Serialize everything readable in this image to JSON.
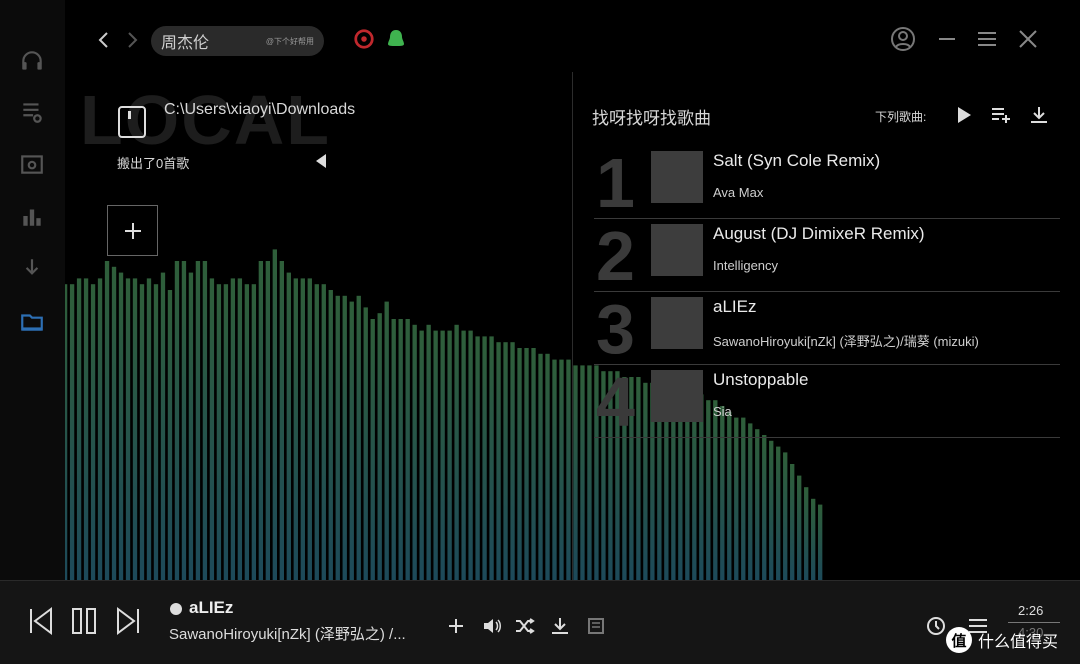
{
  "header": {
    "search_value": "周杰伦",
    "search_hint": "@下个好帮用"
  },
  "rail": {
    "items": [
      "headphones-icon",
      "playlist-icon",
      "radio-icon",
      "chart-icon",
      "download-icon",
      "folder-icon"
    ],
    "active_color": "#2d6fb4"
  },
  "local": {
    "bg_label": "LOCAL",
    "path": "C:\\Users\\xiaoyi\\Downloads",
    "scan_result": "搬出了0首歌"
  },
  "recommend": {
    "title": "找呀找呀找歌曲",
    "next_label": "下列歌曲:",
    "songs": [
      {
        "rank": "1",
        "title": "Salt (Syn Cole Remix)",
        "artist": "Ava Max"
      },
      {
        "rank": "2",
        "title": "August (DJ DimixeR Remix)",
        "artist": "Intelligency"
      },
      {
        "rank": "3",
        "title": "aLIEz",
        "artist": "SawanoHiroyuki[nZk] (泽野弘之)/瑞葵 (mizuki)"
      },
      {
        "rank": "4",
        "title": "Unstoppable",
        "artist": "Sia"
      }
    ]
  },
  "visualizer": {
    "color_top": "#2f5f3a",
    "color_bottom": "#1d4a5a",
    "levels": [
      0.7,
      0.66,
      0.6,
      0.58,
      0.55,
      0.53,
      0.52,
      0.51,
      0.5,
      0.51,
      0.51,
      0.52,
      0.52,
      0.51,
      0.52,
      0.55,
      0.54,
      0.53,
      0.52,
      0.52,
      0.51,
      0.52,
      0.51,
      0.53,
      0.5,
      0.55,
      0.55,
      0.53,
      0.55,
      0.55,
      0.52,
      0.51,
      0.51,
      0.52,
      0.52,
      0.51,
      0.51,
      0.55,
      0.55,
      0.57,
      0.55,
      0.53,
      0.52,
      0.52,
      0.52,
      0.51,
      0.51,
      0.5,
      0.49,
      0.49,
      0.48,
      0.49,
      0.47,
      0.45,
      0.46,
      0.48,
      0.45,
      0.45,
      0.45,
      0.44,
      0.43,
      0.44,
      0.43,
      0.43,
      0.43,
      0.44,
      0.43,
      0.43,
      0.42,
      0.42,
      0.42,
      0.41,
      0.41,
      0.41,
      0.4,
      0.4,
      0.4,
      0.39,
      0.39,
      0.38,
      0.38,
      0.38,
      0.37,
      0.37,
      0.37,
      0.37,
      0.36,
      0.36,
      0.36,
      0.35,
      0.35,
      0.35,
      0.34,
      0.34,
      0.34,
      0.33,
      0.33,
      0.33,
      0.32,
      0.32,
      0.32,
      0.31,
      0.31,
      0.3,
      0.29,
      0.28,
      0.28,
      0.27,
      0.26,
      0.25,
      0.24,
      0.23,
      0.22,
      0.2,
      0.18,
      0.16,
      0.14,
      0.13
    ]
  },
  "player": {
    "title": "aLIEz",
    "artist": "SawanoHiroyuki[nZk] (泽野弘之) /...",
    "current_time": "2:26",
    "total_time": "4:30"
  },
  "watermark": {
    "badge": "值",
    "text": "什么值得买"
  }
}
